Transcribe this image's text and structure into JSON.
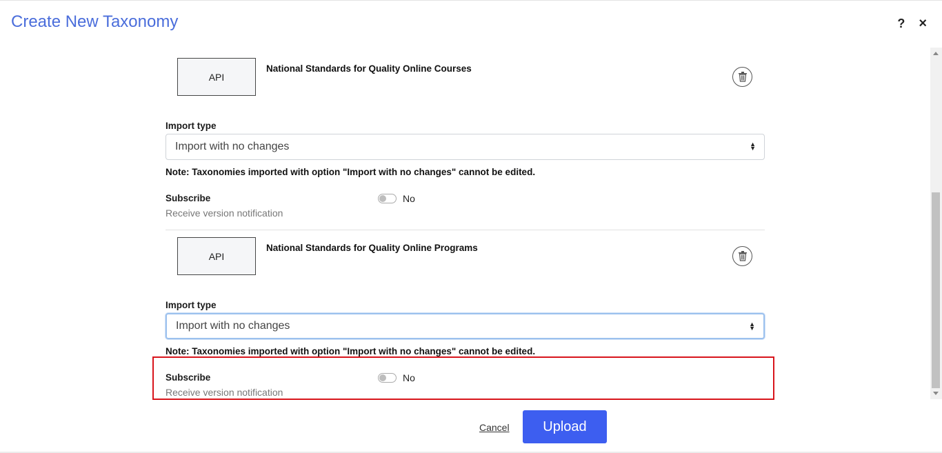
{
  "modal": {
    "title": "Create New Taxonomy",
    "help_label": "?",
    "close_label": "×"
  },
  "taxonomies": [
    {
      "source": "API",
      "name": "National Standards for Quality Online Courses",
      "import_type_label": "Import type",
      "import_type_value": "Import with no changes",
      "note": "Note: Taxonomies imported with option \"Import with no changes\" cannot be edited.",
      "subscribe_label": "Subscribe",
      "subscribe_help": "Receive version notification",
      "subscribe_state": "No",
      "subscribed": false
    },
    {
      "source": "API",
      "name": "National Standards for Quality Online Programs",
      "import_type_label": "Import type",
      "import_type_value": "Import with no changes",
      "note": "Note: Taxonomies imported with option \"Import with no changes\" cannot be edited.",
      "subscribe_label": "Subscribe",
      "subscribe_help": "Receive version notification",
      "subscribe_state": "No",
      "subscribed": false
    }
  ],
  "footer": {
    "cancel_label": "Cancel",
    "upload_label": "Upload"
  },
  "colors": {
    "title": "#4a6ddb",
    "primary_button": "#3d5ef0",
    "highlight_border": "#d8141b"
  },
  "icons": {
    "help": "help-icon",
    "close": "close-icon",
    "delete": "trash-icon",
    "select_caret": "select-caret-icon"
  }
}
